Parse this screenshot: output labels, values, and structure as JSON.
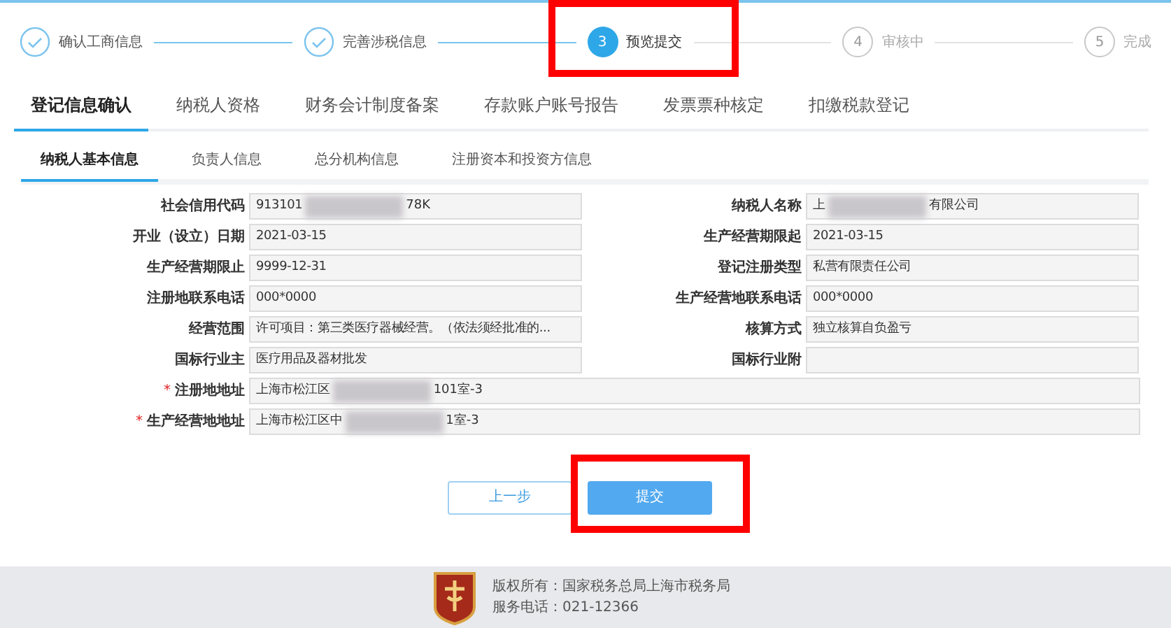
{
  "steps": [
    {
      "label": "确认工商信息",
      "kind": "done",
      "highlighted": false
    },
    {
      "label": "完善涉税信息",
      "kind": "done",
      "highlighted": false
    },
    {
      "number": "3",
      "label": "预览提交",
      "kind": "current",
      "highlighted": true
    },
    {
      "number": "4",
      "label": "审核中",
      "kind": "pending",
      "highlighted": false
    },
    {
      "number": "5",
      "label": "完成",
      "kind": "pending",
      "highlighted": false
    }
  ],
  "tabs": [
    {
      "label": "登记信息确认",
      "selected": true
    },
    {
      "label": "纳税人资格",
      "selected": false
    },
    {
      "label": "财务会计制度备案",
      "selected": false
    },
    {
      "label": "存款账户账号报告",
      "selected": false
    },
    {
      "label": "发票票种核定",
      "selected": false
    },
    {
      "label": "扣缴税款登记",
      "selected": false
    }
  ],
  "subtabs": [
    {
      "label": "纳税人基本信息",
      "selected": true
    },
    {
      "label": "负责人信息",
      "selected": false
    },
    {
      "label": "总分机构信息",
      "selected": false
    },
    {
      "label": "注册资本和投资方信息",
      "selected": false
    }
  ],
  "form_rows": [
    {
      "kind": "pair",
      "fields": [
        {
          "label": "社会信用代码",
          "value": "913101",
          "value_end": "78K",
          "redacted": true
        },
        {
          "label": "纳税人名称",
          "value": "上",
          "value_end": "有限公司",
          "redacted": true
        }
      ]
    },
    {
      "kind": "pair",
      "fields": [
        {
          "label": "开业（设立）日期",
          "value": "2021-03-15"
        },
        {
          "label": "生产经营期限起",
          "value": "2021-03-15"
        }
      ]
    },
    {
      "kind": "pair",
      "fields": [
        {
          "label": "生产经营期限止",
          "value": "9999-12-31"
        },
        {
          "label": "登记注册类型",
          "value": "私营有限责任公司"
        }
      ]
    },
    {
      "kind": "pair",
      "fields": [
        {
          "label": "注册地联系电话",
          "value": "000*0000"
        },
        {
          "label": "生产经营地联系电话",
          "value": "000*0000"
        }
      ]
    },
    {
      "kind": "pair",
      "fields": [
        {
          "label": "经营范围",
          "value": "许可项目：第三类医疗器械经营。（依法须经批准的..."
        },
        {
          "label": "核算方式",
          "value": "独立核算自负盈亏"
        }
      ]
    },
    {
      "kind": "pair",
      "fields": [
        {
          "label": "国标行业主",
          "value": "医疗用品及器材批发"
        },
        {
          "label": "国标行业附"
        }
      ]
    },
    {
      "kind": "wide",
      "fields": [
        {
          "label": "注册地地址",
          "required_mark": "*",
          "value": "上海市松江区",
          "value_end": "101室-3",
          "redacted": true
        }
      ]
    },
    {
      "kind": "wide",
      "fields": [
        {
          "label": "生产经营地地址",
          "required_mark": "*",
          "value": "上海市松江区中",
          "value_end": "1室-3",
          "redacted": true
        }
      ]
    }
  ],
  "buttons": [
    {
      "label": "上一步",
      "kind": "secondary",
      "highlighted": false
    },
    {
      "label": "提交",
      "kind": "primary",
      "highlighted": true
    }
  ],
  "footer": {
    "copyright": "版权所有：国家税务总局上海市税务局",
    "phone": "服务电话：021-12366"
  }
}
